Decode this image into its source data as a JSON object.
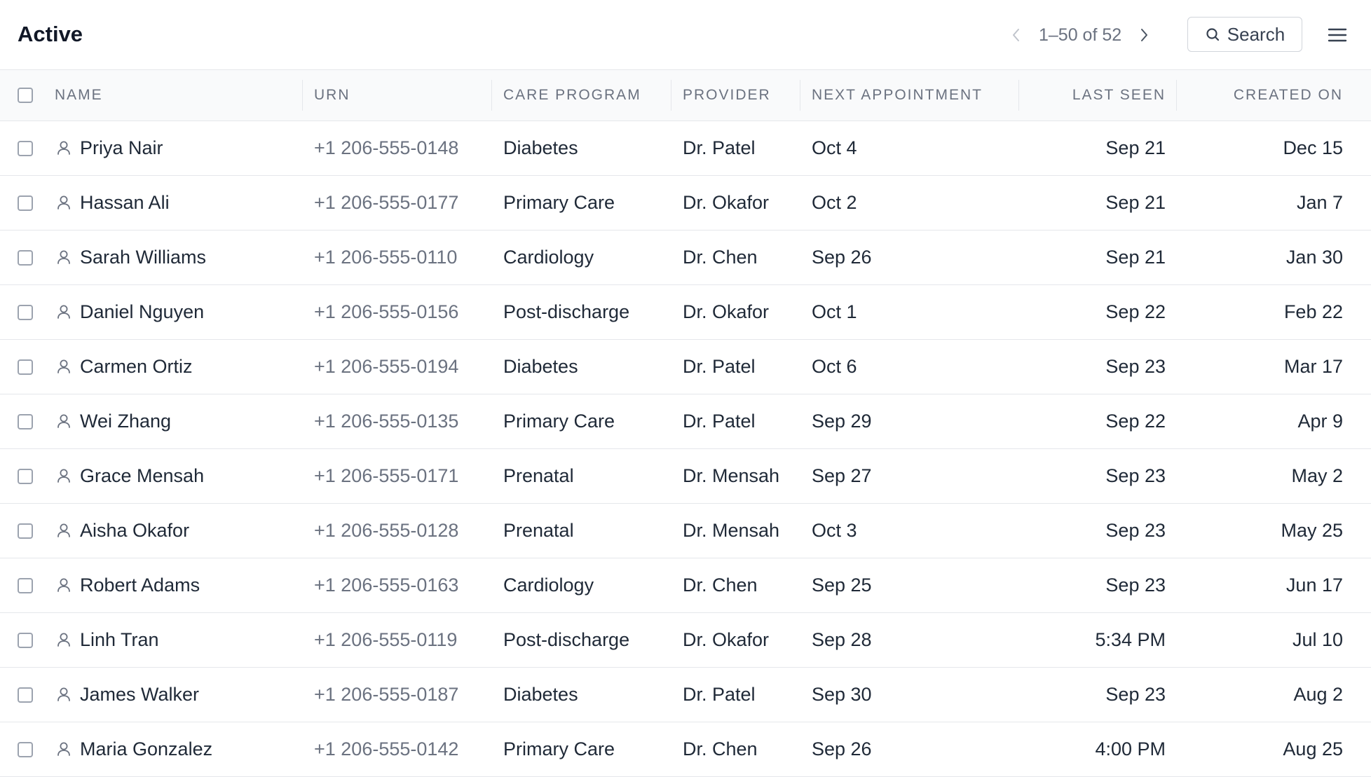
{
  "header": {
    "title": "Active",
    "pagination": "1–50 of 52",
    "search_label": "Search"
  },
  "columns": {
    "name": "NAME",
    "urn": "URN",
    "care_program": "CARE PROGRAM",
    "provider": "PROVIDER",
    "next_appointment": "NEXT APPOINTMENT",
    "last_seen": "LAST SEEN",
    "created_on": "CREATED ON"
  },
  "rows": [
    {
      "name": "Priya Nair",
      "urn": "+1 206-555-0148",
      "care_program": "Diabetes",
      "provider": "Dr. Patel",
      "next_appointment": "Oct 4",
      "last_seen": "Sep 21",
      "created_on": "Dec 15"
    },
    {
      "name": "Hassan Ali",
      "urn": "+1 206-555-0177",
      "care_program": "Primary Care",
      "provider": "Dr. Okafor",
      "next_appointment": "Oct 2",
      "last_seen": "Sep 21",
      "created_on": "Jan 7"
    },
    {
      "name": "Sarah Williams",
      "urn": "+1 206-555-0110",
      "care_program": "Cardiology",
      "provider": "Dr. Chen",
      "next_appointment": "Sep 26",
      "last_seen": "Sep 21",
      "created_on": "Jan 30"
    },
    {
      "name": "Daniel Nguyen",
      "urn": "+1 206-555-0156",
      "care_program": "Post-discharge",
      "provider": "Dr. Okafor",
      "next_appointment": "Oct 1",
      "last_seen": "Sep 22",
      "created_on": "Feb 22"
    },
    {
      "name": "Carmen Ortiz",
      "urn": "+1 206-555-0194",
      "care_program": "Diabetes",
      "provider": "Dr. Patel",
      "next_appointment": "Oct 6",
      "last_seen": "Sep 23",
      "created_on": "Mar 17"
    },
    {
      "name": "Wei Zhang",
      "urn": "+1 206-555-0135",
      "care_program": "Primary Care",
      "provider": "Dr. Patel",
      "next_appointment": "Sep 29",
      "last_seen": "Sep 22",
      "created_on": "Apr 9"
    },
    {
      "name": "Grace Mensah",
      "urn": "+1 206-555-0171",
      "care_program": "Prenatal",
      "provider": "Dr. Mensah",
      "next_appointment": "Sep 27",
      "last_seen": "Sep 23",
      "created_on": "May 2"
    },
    {
      "name": "Aisha Okafor",
      "urn": "+1 206-555-0128",
      "care_program": "Prenatal",
      "provider": "Dr. Mensah",
      "next_appointment": "Oct 3",
      "last_seen": "Sep 23",
      "created_on": "May 25"
    },
    {
      "name": "Robert Adams",
      "urn": "+1 206-555-0163",
      "care_program": "Cardiology",
      "provider": "Dr. Chen",
      "next_appointment": "Sep 25",
      "last_seen": "Sep 23",
      "created_on": "Jun 17"
    },
    {
      "name": "Linh Tran",
      "urn": "+1 206-555-0119",
      "care_program": "Post-discharge",
      "provider": "Dr. Okafor",
      "next_appointment": "Sep 28",
      "last_seen": "5:34 PM",
      "created_on": "Jul 10"
    },
    {
      "name": "James Walker",
      "urn": "+1 206-555-0187",
      "care_program": "Diabetes",
      "provider": "Dr. Patel",
      "next_appointment": "Sep 30",
      "last_seen": "Sep 23",
      "created_on": "Aug 2"
    },
    {
      "name": "Maria Gonzalez",
      "urn": "+1 206-555-0142",
      "care_program": "Primary Care",
      "provider": "Dr. Chen",
      "next_appointment": "Sep 26",
      "last_seen": "4:00 PM",
      "created_on": "Aug 25"
    }
  ],
  "icons": {
    "prev": "chevron-left-icon",
    "next": "chevron-right-icon",
    "search": "search-icon",
    "menu": "menu-icon",
    "person": "person-icon"
  }
}
